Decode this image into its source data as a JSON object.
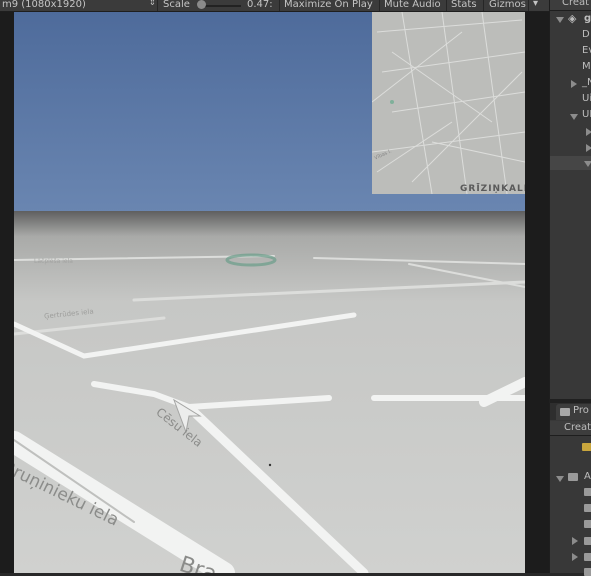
{
  "toolbar": {
    "resolution": "m9 (1080x1920)",
    "scale_label": "Scale",
    "scale_value": "0.47:",
    "maximize": "Maximize On Play",
    "mute": "Mute Audio",
    "stats": "Stats",
    "gizmos": "Gizmos",
    "scale_fraction": 0.1
  },
  "hierarchy": {
    "create": "Creat",
    "scene": "g",
    "items": [
      "D",
      "Ev",
      "M",
      "_N",
      "Ui",
      "UI"
    ]
  },
  "project": {
    "tab": "Pro",
    "create": "Creat",
    "root": "A"
  },
  "game": {
    "minimap_place": "GRĪZIŅKALN",
    "minimap_street": "Vības l.",
    "street_1": "Ģertrūdes iela",
    "street_2": "Cēsu iela",
    "street_3": "Bruņinieku iela",
    "street_4": "Lāčplēša iela",
    "street_5": "Bra"
  },
  "colors": {
    "sky": "#5a78a5",
    "ground": "#c9cbc8",
    "road": "#f2f3f2",
    "accent": "#6f9f8c"
  }
}
